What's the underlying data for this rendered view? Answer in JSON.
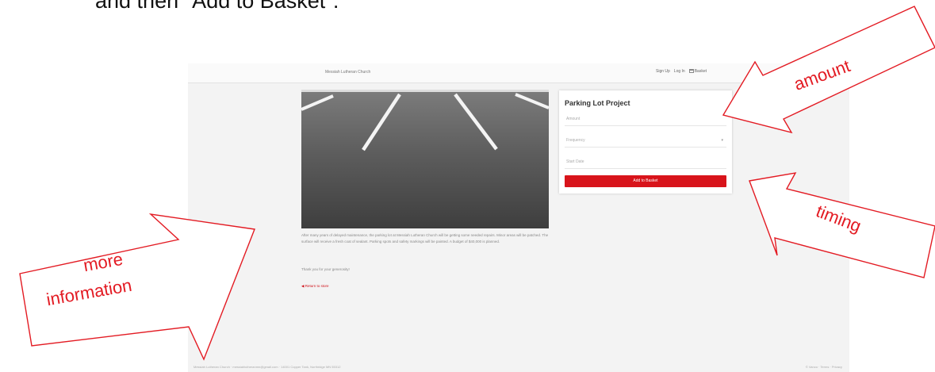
{
  "instruction_text": "and then \"Add to Basket\".",
  "site": {
    "name": "Messiah Lutheran Church",
    "nav": {
      "sign_up": "Sign Up",
      "log_in": "Log In",
      "basket": "Basket"
    }
  },
  "project": {
    "description": "After many years of delayed maintenance, the parking lot at Messiah Lutheran Church will be getting some needed repairs. Minor areas will be patched. The surface will receive a fresh coat of sealant. Parking spots and safety markings will be painted. A budget of $40,000 is planned.",
    "thanks": "Thank you for your generosity!",
    "return_link": "Return to store"
  },
  "donation_form": {
    "title": "Parking Lot Project",
    "amount_placeholder": "Amount",
    "frequency_placeholder": "Frequency",
    "start_date_placeholder": "Start Date",
    "add_button": "Add to Basket"
  },
  "footer": {
    "left": "Messiah Lutheran Church · messiahlutheranmn@gmail.com · 14001 Copper Tank, Northridge MN 55312",
    "right": "© Vanco · Terms · Privacy"
  },
  "callouts": {
    "amount": "amount",
    "timing": "timing",
    "more": "more",
    "information": "information"
  },
  "colors": {
    "callout": "#e31b23",
    "accent": "#d8141b"
  }
}
